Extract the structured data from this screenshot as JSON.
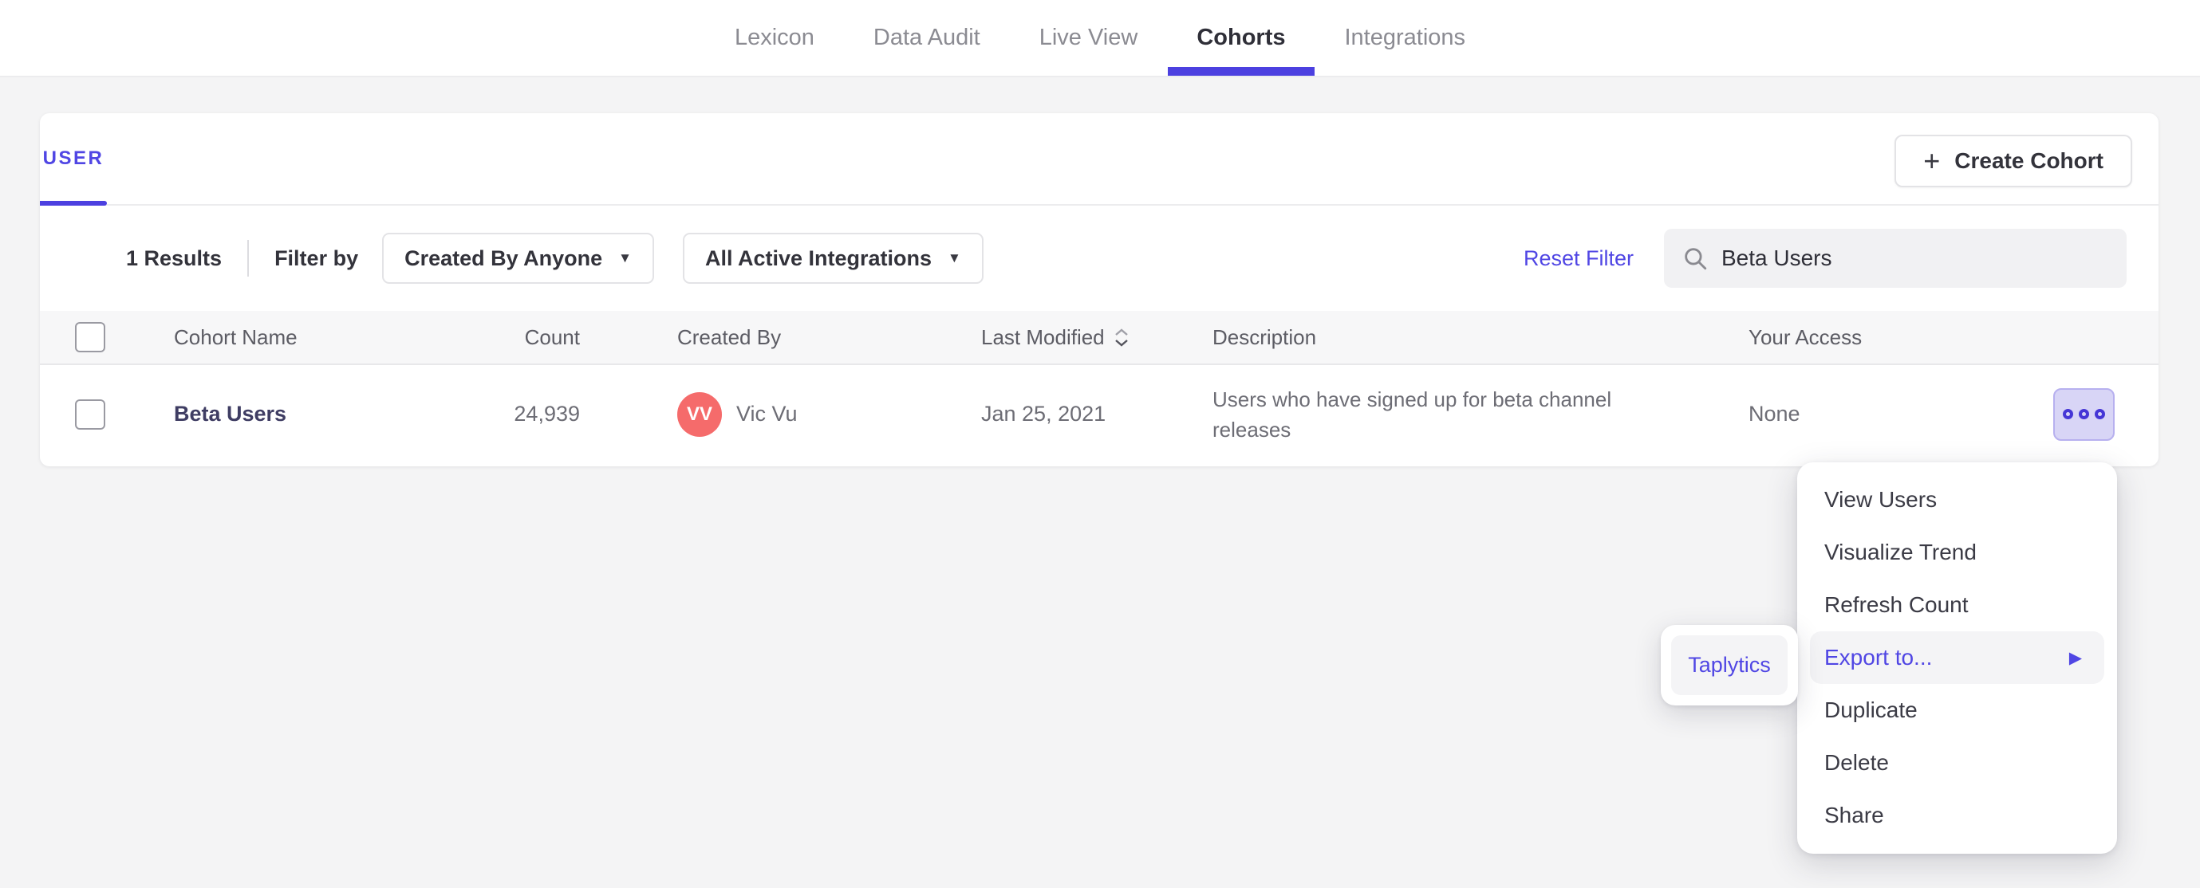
{
  "colors": {
    "accent": "#4c40e0",
    "accent_text": "#5046e4",
    "avatar_bg": "#f56b6b",
    "page_bg": "#f4f4f5",
    "header_bg": "#f7f7f8",
    "more_bg": "#d8d5f6",
    "more_dot": "#4536d6"
  },
  "nav": {
    "tabs": [
      {
        "label": "Lexicon",
        "active": false
      },
      {
        "label": "Data Audit",
        "active": false
      },
      {
        "label": "Live View",
        "active": false
      },
      {
        "label": "Cohorts",
        "active": true
      },
      {
        "label": "Integrations",
        "active": false
      }
    ]
  },
  "cohort_panel": {
    "tab_label": "USER",
    "create_button": {
      "plus": "+",
      "label": "Create Cohort"
    },
    "filter_bar": {
      "results_count": "1 Results",
      "filter_by_label": "Filter by",
      "created_by_dropdown": "Created By Anyone",
      "integrations_dropdown": "All Active Integrations",
      "dropdown_caret": "▼",
      "reset_filter_label": "Reset Filter",
      "search": {
        "value": "Beta Users"
      }
    },
    "table": {
      "headers": [
        "Cohort Name",
        "Count",
        "Created By",
        "Last Modified",
        "Description",
        "Your Access"
      ],
      "rows": [
        {
          "name": "Beta Users",
          "count": "24,939",
          "avatar_initials": "VV",
          "created_by": "Vic Vu",
          "last_modified": "Jan 25, 2021",
          "description": "Users who have signed up for beta channel releases",
          "your_access": "None"
        }
      ]
    }
  },
  "context_menu": {
    "items": [
      "View Users",
      "Visualize Trend",
      "Refresh Count",
      "Export to...",
      "Duplicate",
      "Delete",
      "Share"
    ],
    "highlighted_item": "Export to...",
    "submenu_arrow": "▶",
    "submenu": {
      "items": [
        "Taplytics"
      ]
    }
  }
}
